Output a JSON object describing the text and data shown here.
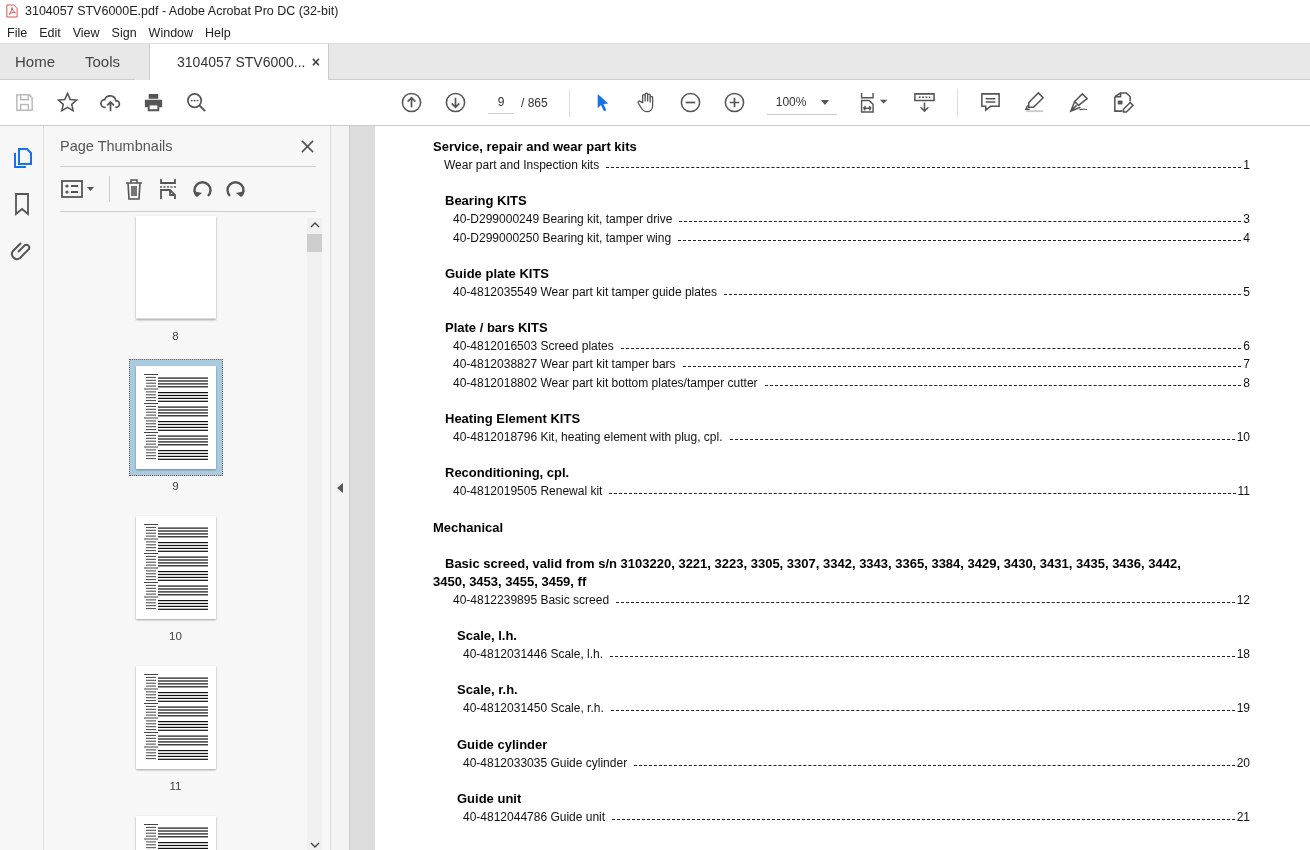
{
  "window": {
    "title": "3104057 STV6000E.pdf - Adobe Acrobat Pro DC (32-bit)"
  },
  "menu": [
    "File",
    "Edit",
    "View",
    "Sign",
    "Window",
    "Help"
  ],
  "tabs": [
    {
      "label": "Home",
      "selected": false,
      "kind": "nav"
    },
    {
      "label": "Tools",
      "selected": false,
      "kind": "nav"
    },
    {
      "label": "3104057 STV6000...",
      "selected": true,
      "kind": "document",
      "close": "×"
    }
  ],
  "toolbar": {
    "page": "9",
    "page_count": "/ 865",
    "zoom": "100%",
    "tools": [
      {
        "kind": "select",
        "selected": true
      },
      {
        "kind": "hand",
        "selected": false
      }
    ]
  },
  "rail": [
    {
      "kind": "thumbnails",
      "selected": true
    },
    {
      "kind": "bookmarks",
      "selected": false
    },
    {
      "kind": "attachments",
      "selected": false
    }
  ],
  "side_panel": {
    "title": "Page Thumbnails",
    "thumbnails": [
      {
        "label": "8",
        "kind": "blank",
        "selected": false
      },
      {
        "label": "9",
        "kind": "text",
        "selected": true
      },
      {
        "label": "10",
        "kind": "text",
        "selected": false
      },
      {
        "label": "11",
        "kind": "text",
        "selected": false
      },
      {
        "kind": "text",
        "selected": false
      }
    ]
  },
  "document": {
    "sections": [
      {
        "heading": "Service, repair and wear part kits",
        "entries": [
          {
            "text": "Wear part and Inspection kits",
            "page": "1"
          }
        ],
        "children": [
          {
            "heading": "Bearing KITS",
            "entries": [
              {
                "text": "40-D299000249 Bearing kit, tamper drive",
                "page": "3"
              },
              {
                "text": "40-D299000250 Bearing kit, tamper wing",
                "page": "4"
              }
            ]
          },
          {
            "heading": "Guide plate KITS",
            "entries": [
              {
                "text": "40-4812035549 Wear part kit tamper guide plates",
                "page": "5"
              }
            ]
          },
          {
            "heading": "Plate / bars KITS",
            "entries": [
              {
                "text": "40-4812016503 Screed plates",
                "page": "6"
              },
              {
                "text": "40-4812038827 Wear part kit tamper bars",
                "page": "7"
              },
              {
                "text": "40-4812018802 Wear part kit bottom plates/tamper cutter",
                "page": "8"
              }
            ]
          },
          {
            "heading": "Heating Element KITS",
            "entries": [
              {
                "text": "40-4812018796 Kit, heating element with plug, cpl.",
                "page": "10"
              }
            ]
          },
          {
            "heading": "Reconditioning, cpl.",
            "entries": [
              {
                "text": "40-4812019505 Renewal kit",
                "page": "11"
              }
            ]
          }
        ]
      },
      {
        "heading": "Mechanical",
        "children": [
          {
            "heading": "Basic screed, valid from s/n 3103220, 3221, 3223, 3305, 3307, 3342, 3343, 3365, 3384, 3429, 3430, 3431, 3435, 3436, 3442, 3450, 3453, 3455, 3459, ff",
            "entries": [
              {
                "text": "40-4812239895 Basic screed",
                "page": "12"
              }
            ],
            "children": [
              {
                "heading": "Scale, l.h.",
                "entries": [
                  {
                    "text": "40-4812031446 Scale, l.h.",
                    "page": "18"
                  }
                ]
              },
              {
                "heading": "Scale, r.h.",
                "entries": [
                  {
                    "text": "40-4812031450 Scale, r.h.",
                    "page": "19"
                  }
                ]
              },
              {
                "heading": "Guide cylinder",
                "entries": [
                  {
                    "text": "40-4812033035 Guide cylinder",
                    "page": "20"
                  }
                ]
              },
              {
                "heading": "Guide unit",
                "entries": [
                  {
                    "text": "40-4812044786 Guide unit",
                    "page": "21"
                  }
                ]
              }
            ]
          }
        ]
      }
    ]
  }
}
